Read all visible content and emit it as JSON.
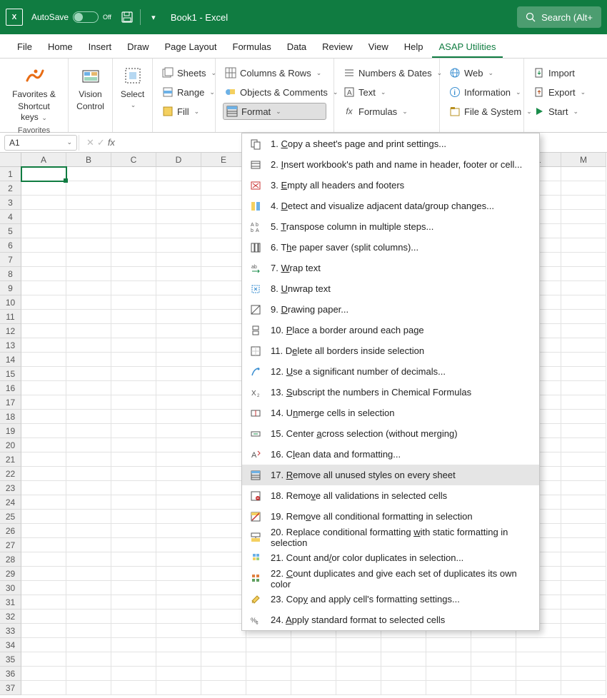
{
  "titlebar": {
    "autosave_label": "AutoSave",
    "autosave_state": "Off",
    "doc_title": "Book1  -  Excel",
    "search_label": "Search (Alt+"
  },
  "tabs": {
    "items": [
      "File",
      "Home",
      "Insert",
      "Draw",
      "Page Layout",
      "Formulas",
      "Data",
      "Review",
      "View",
      "Help",
      "ASAP Utilities"
    ],
    "active_index": 10
  },
  "ribbon": {
    "favorites_label": "Favorites &",
    "favorites_label2": "Shortcut keys",
    "favorites_group_label": "Favorites",
    "vision_label": "Vision",
    "vision_label2": "Control",
    "select_label": "Select",
    "col1": {
      "sheets": "Sheets",
      "range": "Range",
      "fill": "Fill"
    },
    "col2": {
      "columns": "Columns & Rows",
      "objects": "Objects & Comments",
      "format": "Format"
    },
    "col3": {
      "numbers": "Numbers & Dates",
      "text": "Text",
      "formulas": "Formulas"
    },
    "col4": {
      "web": "Web",
      "information": "Information",
      "filesys": "File & System"
    },
    "col5": {
      "import": "Import",
      "export": "Export",
      "start": "Start"
    }
  },
  "namebox": "A1",
  "columns": [
    "A",
    "B",
    "C",
    "D",
    "E",
    "",
    "",
    "",
    "",
    "",
    "",
    "L",
    "M"
  ],
  "rows": 37,
  "dropdown": {
    "highlight_index": 16,
    "items": [
      {
        "n": "1",
        "pre": "",
        "u": "C",
        "post": "opy a sheet's page and print settings..."
      },
      {
        "n": "2",
        "pre": "",
        "u": "I",
        "post": "nsert workbook's path and name in header, footer or cell..."
      },
      {
        "n": "3",
        "pre": "",
        "u": "E",
        "post": "mpty all headers and footers"
      },
      {
        "n": "4",
        "pre": "",
        "u": "D",
        "post": "etect and visualize adjacent data/group changes..."
      },
      {
        "n": "5",
        "pre": "",
        "u": "T",
        "post": "ranspose column in multiple steps..."
      },
      {
        "n": "6",
        "pre": "T",
        "u": "h",
        "post": "e paper saver (split columns)..."
      },
      {
        "n": "7",
        "pre": "",
        "u": "W",
        "post": "rap text"
      },
      {
        "n": "8",
        "pre": "",
        "u": "U",
        "post": "nwrap text"
      },
      {
        "n": "9",
        "pre": "",
        "u": "D",
        "post": "rawing paper..."
      },
      {
        "n": "10",
        "pre": "",
        "u": "P",
        "post": "lace a border around each page"
      },
      {
        "n": "11",
        "pre": "D",
        "u": "e",
        "post": "lete all borders inside selection"
      },
      {
        "n": "12",
        "pre": "",
        "u": "U",
        "post": "se a significant number of decimals..."
      },
      {
        "n": "13",
        "pre": "",
        "u": "S",
        "post": "ubscript the numbers in Chemical Formulas"
      },
      {
        "n": "14",
        "pre": "U",
        "u": "n",
        "post": "merge cells in selection"
      },
      {
        "n": "15",
        "pre": "Center ",
        "u": "a",
        "post": "cross selection (without merging)"
      },
      {
        "n": "16",
        "pre": "C",
        "u": "l",
        "post": "ean data and formatting..."
      },
      {
        "n": "17",
        "pre": "",
        "u": "R",
        "post": "emove all unused styles on every sheet"
      },
      {
        "n": "18",
        "pre": "Remo",
        "u": "v",
        "post": "e all validations in selected cells"
      },
      {
        "n": "19",
        "pre": "Rem",
        "u": "o",
        "post": "ve all conditional formatting in selection"
      },
      {
        "n": "20",
        "pre": "Replace conditional formatting ",
        "u": "w",
        "post": "ith static formatting in selection"
      },
      {
        "n": "21",
        "pre": "Count and",
        "u": "/",
        "post": "or color duplicates in selection..."
      },
      {
        "n": "22",
        "pre": "",
        "u": "C",
        "post": "ount duplicates and give each set of duplicates its own color"
      },
      {
        "n": "23",
        "pre": "Cop",
        "u": "y",
        "post": " and apply cell's formatting settings..."
      },
      {
        "n": "24",
        "pre": "",
        "u": "A",
        "post": "pply standard format to selected cells"
      }
    ]
  }
}
